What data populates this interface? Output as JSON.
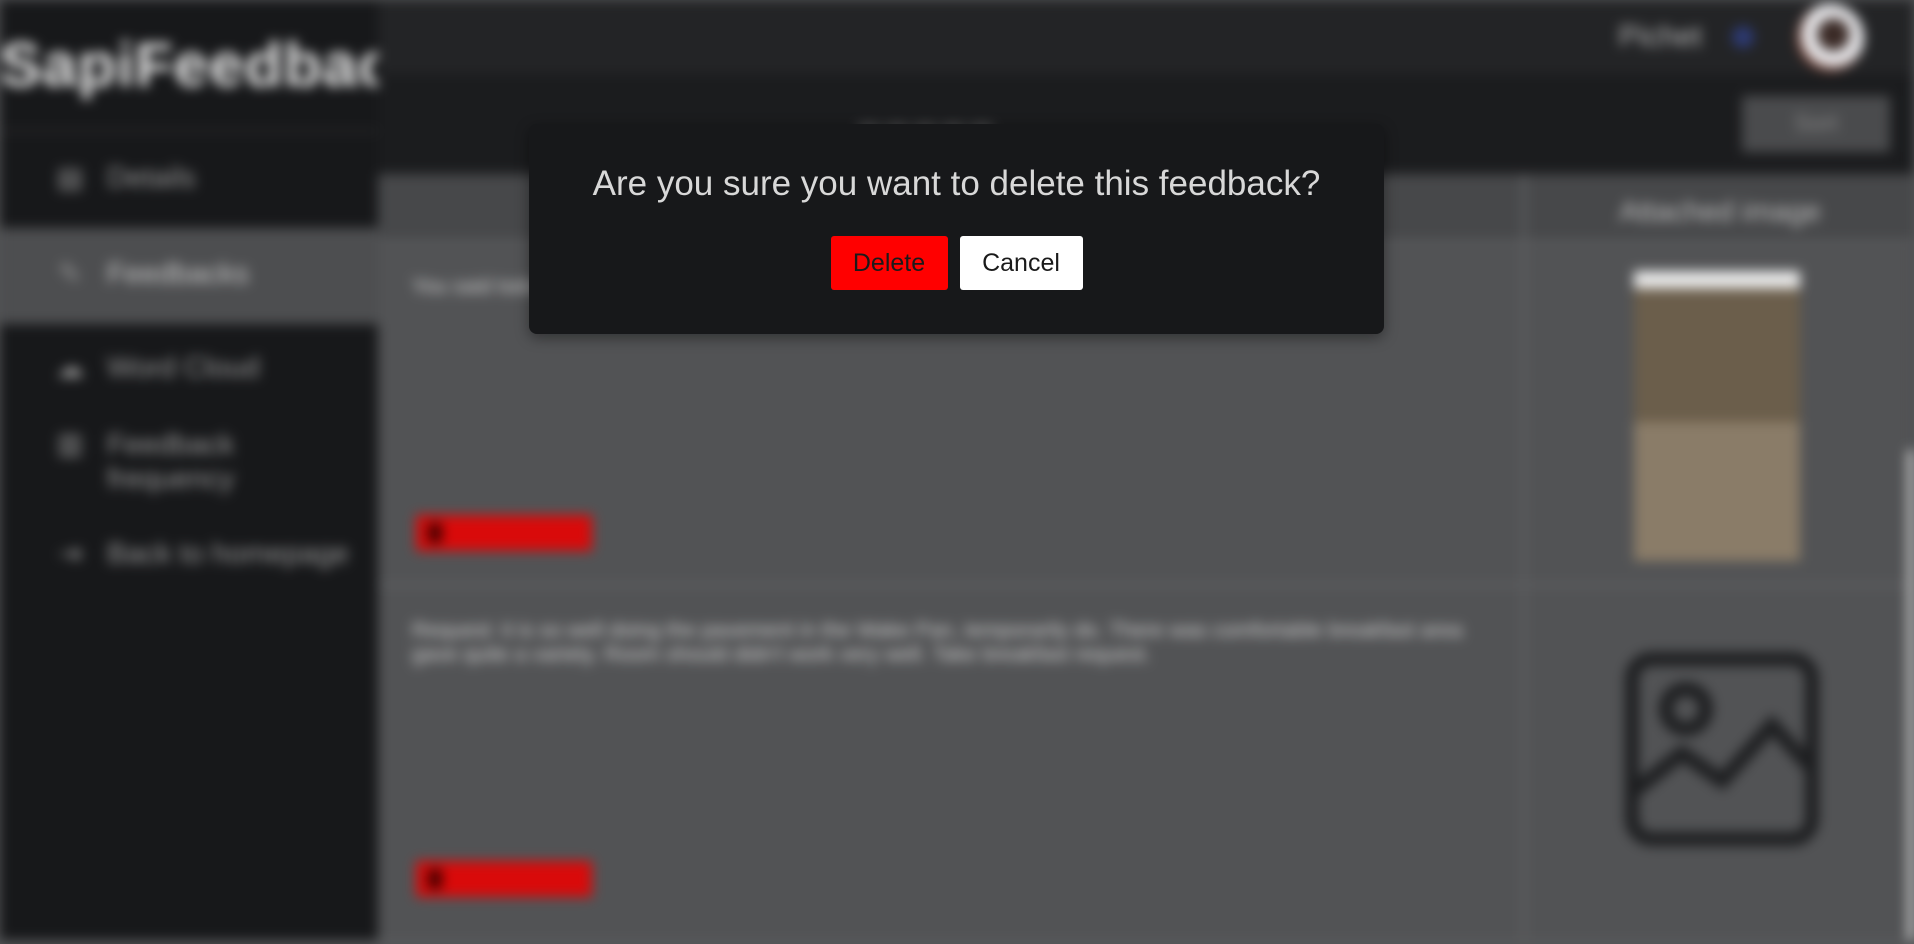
{
  "app": {
    "brand": "SapiFeedback"
  },
  "sidebar": {
    "items": [
      {
        "label": "Details",
        "icon": "clipboard-icon"
      },
      {
        "label": "Feedbacks",
        "icon": "edit-icon"
      },
      {
        "label": "Word Cloud",
        "icon": "cloud-icon"
      },
      {
        "label": "Feedback frequency",
        "icon": "bar-chart-icon"
      },
      {
        "label": "Back to homepage",
        "icon": "exit-icon"
      }
    ]
  },
  "topbar": {
    "user_name": "Pichet"
  },
  "toolbar": {
    "sort_label": "Sort"
  },
  "table": {
    "col_image": "Attached image",
    "rows": [
      {
        "text": "You said today..."
      },
      {
        "text": "Request: it is so well doing the pavement in the Wake Pan, temporarily do. There was comfortable breakfast area gave quite a variety. Room should didn't work very well. Take breakfast request."
      }
    ]
  },
  "modal": {
    "title": "Are you sure you want to delete this feedback?",
    "delete_label": "Delete",
    "cancel_label": "Cancel"
  },
  "colors": {
    "danger": "#ff0000",
    "modal_bg": "#17181a",
    "page_bg": "#525355"
  }
}
